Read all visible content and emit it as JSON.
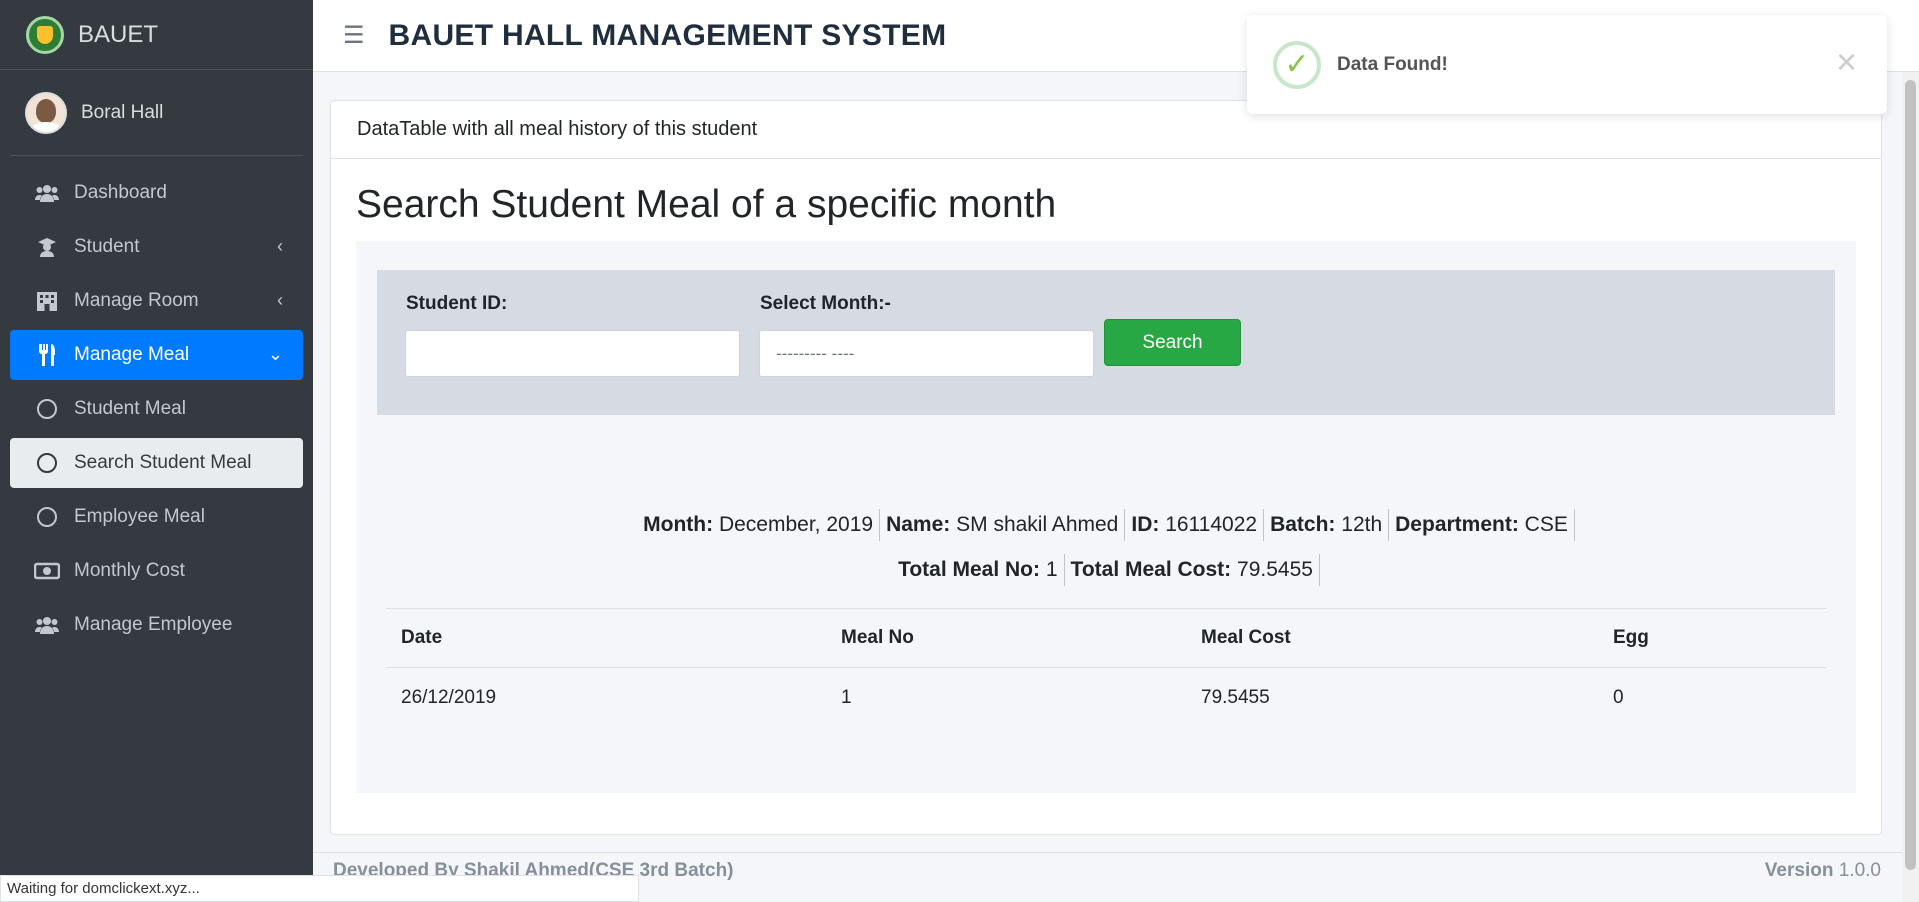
{
  "brand": {
    "name": "BAUET"
  },
  "user": {
    "name": "Boral Hall"
  },
  "sidebar": {
    "items": [
      {
        "label": "Dashboard",
        "icon": "users-icon"
      },
      {
        "label": "Student",
        "icon": "graduate-icon"
      },
      {
        "label": "Manage Room",
        "icon": "building-icon"
      },
      {
        "label": "Manage Meal",
        "icon": "utensils-icon"
      },
      {
        "label": "Student Meal",
        "icon": "circle-icon"
      },
      {
        "label": "Search Student Meal",
        "icon": "circle-icon"
      },
      {
        "label": "Employee Meal",
        "icon": "circle-icon"
      },
      {
        "label": "Monthly Cost",
        "icon": "money-icon"
      },
      {
        "label": "Manage Employee",
        "icon": "users-icon"
      }
    ]
  },
  "header": {
    "title": "BAUET HALL MANAGEMENT SYSTEM"
  },
  "card": {
    "header": "DataTable with all meal history of this student",
    "heading": "Search Student Meal of a specific month"
  },
  "search": {
    "student_id_label": "Student ID:",
    "student_id_value": "",
    "month_label": "Select Month:-",
    "month_placeholder": "--------- ----",
    "button": "Search"
  },
  "info": {
    "month_label": "Month:",
    "month": "December, 2019",
    "name_label": "Name:",
    "name": "SM shakil Ahmed",
    "id_label": "ID:",
    "id": "16114022",
    "batch_label": "Batch:",
    "batch": "12th",
    "dept_label": "Department:",
    "dept": "CSE",
    "total_meal_label": "Total Meal No:",
    "total_meal": "1",
    "total_cost_label": "Total Meal Cost:",
    "total_cost": "79.5455"
  },
  "table": {
    "columns": [
      "Date",
      "Meal No",
      "Meal Cost",
      "Egg"
    ],
    "rows": [
      [
        "26/12/2019",
        "1",
        "79.5455",
        "0"
      ]
    ]
  },
  "footer": {
    "left": "Developed By Shakil Ahmed(CSE 3rd Batch)",
    "version_label": "Version",
    "version": "1.0.0"
  },
  "status": {
    "text": "Waiting for domclickext.xyz..."
  },
  "toast": {
    "message": "Data Found!"
  },
  "colors": {
    "sidebar": "#343a40",
    "active": "#007bff",
    "success": "#28a745"
  }
}
